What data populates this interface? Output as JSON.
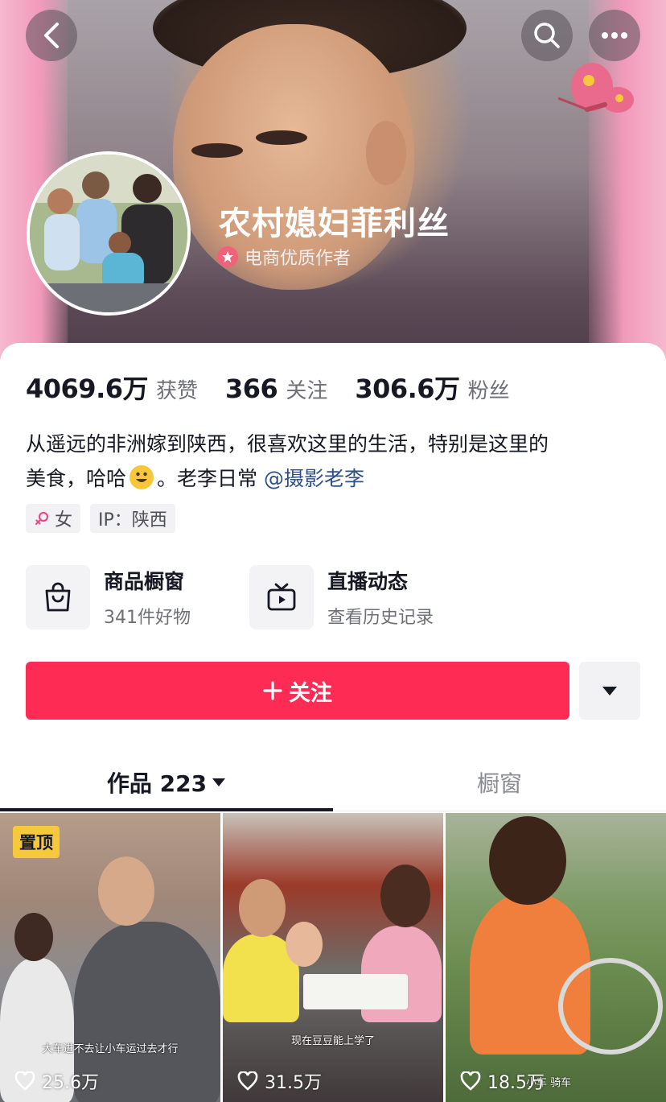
{
  "profile": {
    "nickname": "农村媳妇菲利丝",
    "badge": "电商优质作者"
  },
  "stats": {
    "likes_value": "4069.6万",
    "likes_label": "获赞",
    "following_value": "366",
    "following_label": "关注",
    "followers_value": "306.6万",
    "followers_label": "粉丝"
  },
  "bio": {
    "line1": "从遥远的非洲嫁到陕西，很喜欢这里的生活，特别是这里的",
    "line2_before": "美食，哈哈",
    "line2_after": "。老李日常 ",
    "mention": "@摄影老李"
  },
  "tags": {
    "gender": "女",
    "ip": "IP：陕西"
  },
  "entries": {
    "shop_title": "商品橱窗",
    "shop_sub": "341件好物",
    "live_title": "直播动态",
    "live_sub": "查看历史记录"
  },
  "actions": {
    "follow_label": "关注"
  },
  "tabs": {
    "works_label": "作品 223",
    "showcase_label": "橱窗"
  },
  "videos": [
    {
      "pinned": "置顶",
      "caption": "大车进不去让小车运过去才行",
      "likes": "25.6万"
    },
    {
      "caption": "现在豆豆能上学了",
      "likes": "31.5万"
    },
    {
      "caption": "小车 骑车",
      "likes": "18.5万"
    }
  ],
  "colors": {
    "follow_button": "#fe2c55",
    "pinned_badge": "#f6c93c",
    "mention": "#2f4f8c",
    "badge_star": "#f0627a"
  },
  "icons": {
    "back": "chevron-left-icon",
    "search": "search-icon",
    "more": "more-dots-icon",
    "shop": "shopping-bag-icon",
    "live": "tv-icon",
    "dropdown": "caret-down-icon",
    "likes": "heart-icon",
    "gender": "female-icon",
    "badge": "star-icon"
  }
}
